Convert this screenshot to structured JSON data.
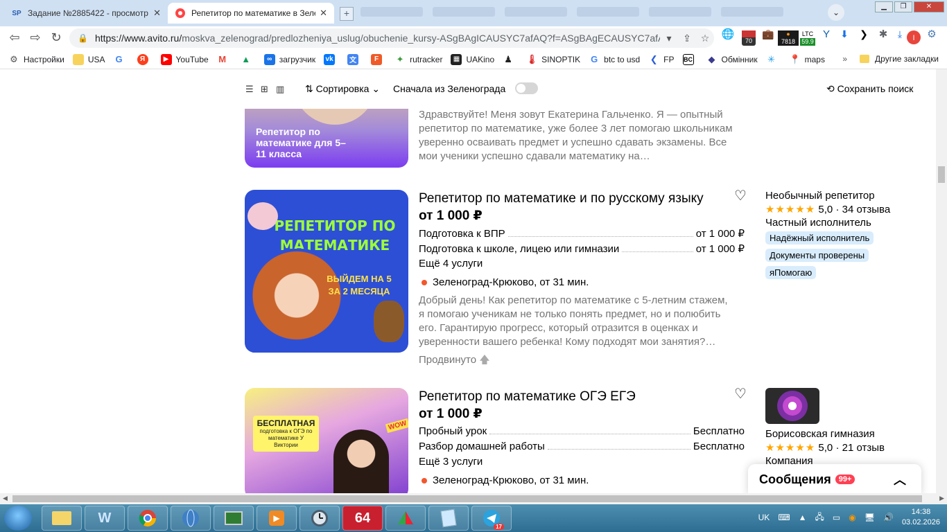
{
  "browser": {
    "tabs": [
      {
        "title": "Задание №2885422 - просмотр з",
        "icon": "SP"
      },
      {
        "title": "Репетитор по математике в Зеле",
        "icon": "avito"
      }
    ],
    "url_main": "https://www.avito.ru/",
    "url_rest": "moskva_zelenograd/predlozheniya_uslug/obuchenie_kursy-ASgBAgICAUSYC7afAQ?f=ASgBAgECAUSYC7afAQ...",
    "ext_badges": {
      "num70": "70",
      "num7818": "7818",
      "ltc": "LTC",
      "ltc_val": "59.9"
    },
    "bookmarks": [
      {
        "label": "Настройки",
        "icon": "gear-icon"
      },
      {
        "label": "USA",
        "icon": "folder-icon"
      },
      {
        "label": "",
        "icon": "google-icon"
      },
      {
        "label": "",
        "icon": "yandex-icon"
      },
      {
        "label": "YouTube",
        "icon": "youtube-icon"
      },
      {
        "label": "",
        "icon": "gmail-icon"
      },
      {
        "label": "",
        "icon": "drive-icon"
      },
      {
        "label": "загрузчик",
        "icon": "infinity-icon"
      },
      {
        "label": "",
        "icon": "vk-icon"
      },
      {
        "label": "",
        "icon": "translate-icon"
      },
      {
        "label": "",
        "icon": "f-icon"
      },
      {
        "label": "rutracker",
        "icon": "rutracker-icon"
      },
      {
        "label": "UAKino",
        "icon": "uakino-icon"
      },
      {
        "label": "",
        "icon": "figure-icon"
      },
      {
        "label": "SINOPTIK",
        "icon": "thermometer-icon"
      },
      {
        "label": "btc to usd",
        "icon": "google-icon"
      },
      {
        "label": "FP",
        "icon": "fp-icon"
      },
      {
        "label": "",
        "icon": "bc-icon"
      },
      {
        "label": "Обмінник",
        "icon": "exchange-icon"
      },
      {
        "label": "",
        "icon": "snowflake-icon"
      },
      {
        "label": "maps",
        "icon": "maps-icon"
      }
    ],
    "bookmarks_more": "»",
    "other_bookmarks": "Другие закладки"
  },
  "sortbar": {
    "sort_label": "Сортировка",
    "zelenograd_first": "Сначала из Зеленограда",
    "save_search": "Сохранить поиск"
  },
  "cards": [
    {
      "photo_caption": "Репетитор по математике для 5–11 класса",
      "description": "Здравствуйте! Меня зовут Екатерина Гальченко. Я — опытный репетитор по математике, уже более 3 лет помогаю школьникам уверенно осваивать предмет и успешно сдавать экзамены. Все мои ученики успешно сдавали математику на…"
    },
    {
      "title": "Репетитор по математике и по русскому языку",
      "price": "от 1 000 ₽",
      "photo_text1": "РЕПЕТИТОР ПО МАТЕМАТИКЕ",
      "photo_text2": "ВЫЙДЕМ НА 5 ЗА 2 МЕСЯЦА",
      "services": [
        {
          "name": "Подготовка к ВПР",
          "price": "от 1 000 ₽"
        },
        {
          "name": "Подготовка к школе, лицею или гимназии",
          "price": "от 1 000 ₽"
        }
      ],
      "more": "Ещё 4 услуги",
      "location": "Зеленоград-Крюково, от 31 мин.",
      "description": "Добрый день! Как репетитор по математике с 5-летним стажем, я помогаю ученикам не только понять предмет, но и полюбить его. Гарантирую прогресс, который отразится в оценках и уверенности вашего ребенка! Кому подходят мои занятия?…",
      "promoted": "Продвинуто",
      "seller_name": "Необычный репетитор",
      "rating": "5,0",
      "stars": "★★★★★",
      "reviews": "34 отзыва",
      "seller_type": "Частный исполнитель",
      "badges": [
        "Надёжный исполнитель",
        "Документы проверены",
        "яПомогаю"
      ]
    },
    {
      "title": "Репетитор по математике ОГЭ ЕГЭ",
      "price": "от 1 000 ₽",
      "photo_text1": "БЕСПЛАТНАЯ",
      "photo_text2": "подготовка к ОГЭ по математике У Виктории",
      "photo_wow": "WOW",
      "services": [
        {
          "name": "Пробный урок",
          "price": "Бесплатно"
        },
        {
          "name": "Разбор домашней работы",
          "price": "Бесплатно"
        }
      ],
      "more": "Ещё 3 услуги",
      "location": "Зеленоград-Крюково, от 31 мин.",
      "seller_name": "Борисовская гимназия",
      "rating": "5,0",
      "stars": "★★★★★",
      "reviews": "21 отзыв",
      "seller_type": "Компания"
    }
  ],
  "messages": {
    "label": "Сообщения",
    "count": "99+"
  },
  "taskbar": {
    "lang": "UK",
    "time": "14:38",
    "date": "03.02.2026",
    "app64": "64",
    "tg_badge": "17"
  },
  "colors": {
    "accent_blue": "#0099f7",
    "promo_dot": "#f2572d",
    "badge_bg": "#d8ecfc",
    "star": "#ffa500"
  }
}
